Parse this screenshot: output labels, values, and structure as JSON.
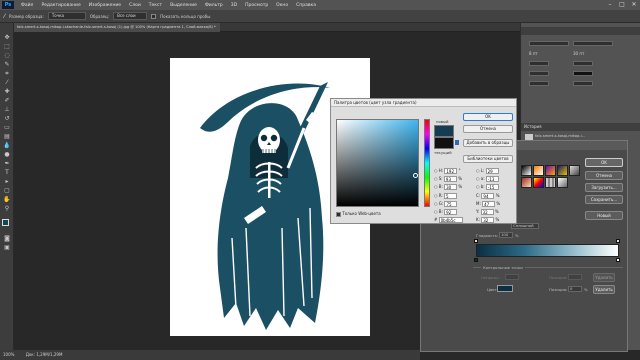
{
  "app": {
    "logo": "Ps"
  },
  "menu": [
    "Файл",
    "Редактирование",
    "Изображение",
    "Слои",
    "Текст",
    "Выделение",
    "Фильтр",
    "3D",
    "Просмотр",
    "Окно",
    "Справка"
  ],
  "options": {
    "sample_size_label": "Размер образца:",
    "sample_size_value": "Точка",
    "sample_label": "Образец:",
    "sample_value": "Все слои",
    "show_ring_label": "Показать кольцо пробы"
  },
  "document": {
    "tab_title": "falx-smert-s-kosoj-mikop-i-skachanie-falx-smert-s-kosoj (1).jpg @ 100% (Карта градиента 1, Слой-маска/8) *"
  },
  "status": {
    "zoom": "100%",
    "doc_info": "Док: 1,29М/1,29М"
  },
  "color_picker": {
    "title": "Палитра цветов (цвет узла градиента)",
    "new_label": "новый",
    "current_label": "текущий",
    "ok": "OK",
    "cancel": "Отмена",
    "add_to_swatches": "Добавить в образцы",
    "color_libraries": "Библиотеки цветов",
    "web_only": "Только Web-цвета",
    "h": "192",
    "s": "93",
    "b": "30",
    "r": "5",
    "g": "75",
    "bl": "92",
    "l": "29",
    "a": "-13",
    "b_lab": "-15",
    "c": "94",
    "m": "47",
    "y": "32",
    "k": "32",
    "hex": "0b4b5c",
    "deg": "°",
    "pct": "%",
    "hex_prefix": "#"
  },
  "gradient_editor": {
    "ok": "OK",
    "cancel": "Отмена",
    "load": "Загрузить...",
    "save": "Сохранить...",
    "new": "Новый",
    "smoothness_label": "Гладкость:",
    "smoothness_value": "100",
    "type_value": "Сплошной",
    "control_points_label": "Контрольные точки",
    "opacity_label": "Непрозр.:",
    "position_label": "Позиция:",
    "delete": "Удалить",
    "color_label": "Цвет:",
    "color_position_value": "0",
    "pct": "%",
    "colors": {
      "start": "#0b2f44",
      "end": "#ffffff"
    }
  },
  "dock": {
    "panel_history": "История",
    "layer_name": "falx-smert-s-kosoj-mikop-i...",
    "font_size": "8 пт",
    "tracking": "30 пт",
    "layers_item_1": "Диффузия",
    "layers_item_2": "Фоновые"
  },
  "colors": {
    "accent": "#31a8ff",
    "fg": "#0b4b5c",
    "bg": "#ffffff"
  }
}
